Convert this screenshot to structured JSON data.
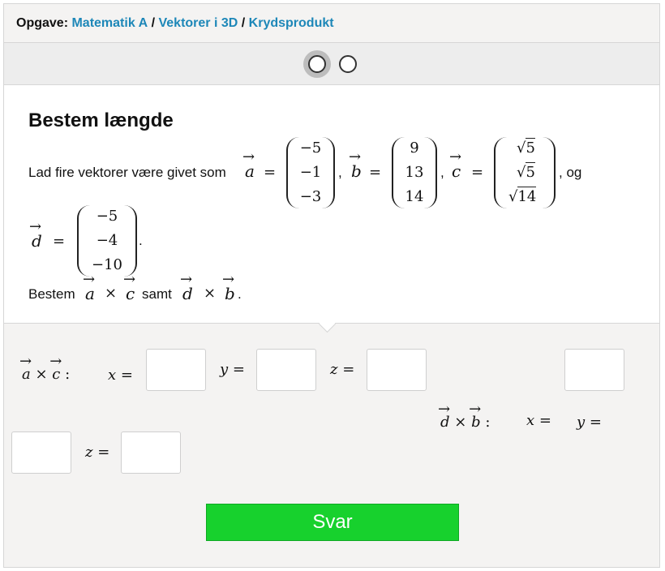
{
  "breadcrumb": {
    "prefix": "Opgave:",
    "items": [
      "Matematik A",
      "Vektorer i 3D",
      "Krydsprodukt"
    ],
    "sep": "/"
  },
  "pager": {
    "pages": 2,
    "current": 1
  },
  "problem": {
    "title": "Bestem længde",
    "intro": "Lad fire vektorer være givet som",
    "og": ", og",
    "period": ".",
    "task_prefix": "Bestem",
    "task_mid": "samt",
    "vectors": {
      "a": [
        "−5",
        "−1",
        "−3"
      ],
      "b": [
        "9",
        "13",
        "14"
      ],
      "c": [
        "5",
        "5",
        "14"
      ],
      "d": [
        "−5",
        "−4",
        "−10"
      ]
    }
  },
  "answer": {
    "row1_label": "a × c :",
    "row2_label": "d × b :",
    "x_label": "x =",
    "y_label": "y =",
    "z_label": "z =",
    "submit_label": "Svar"
  },
  "colors": {
    "link": "#1d87b8",
    "submit": "#17d12d"
  }
}
